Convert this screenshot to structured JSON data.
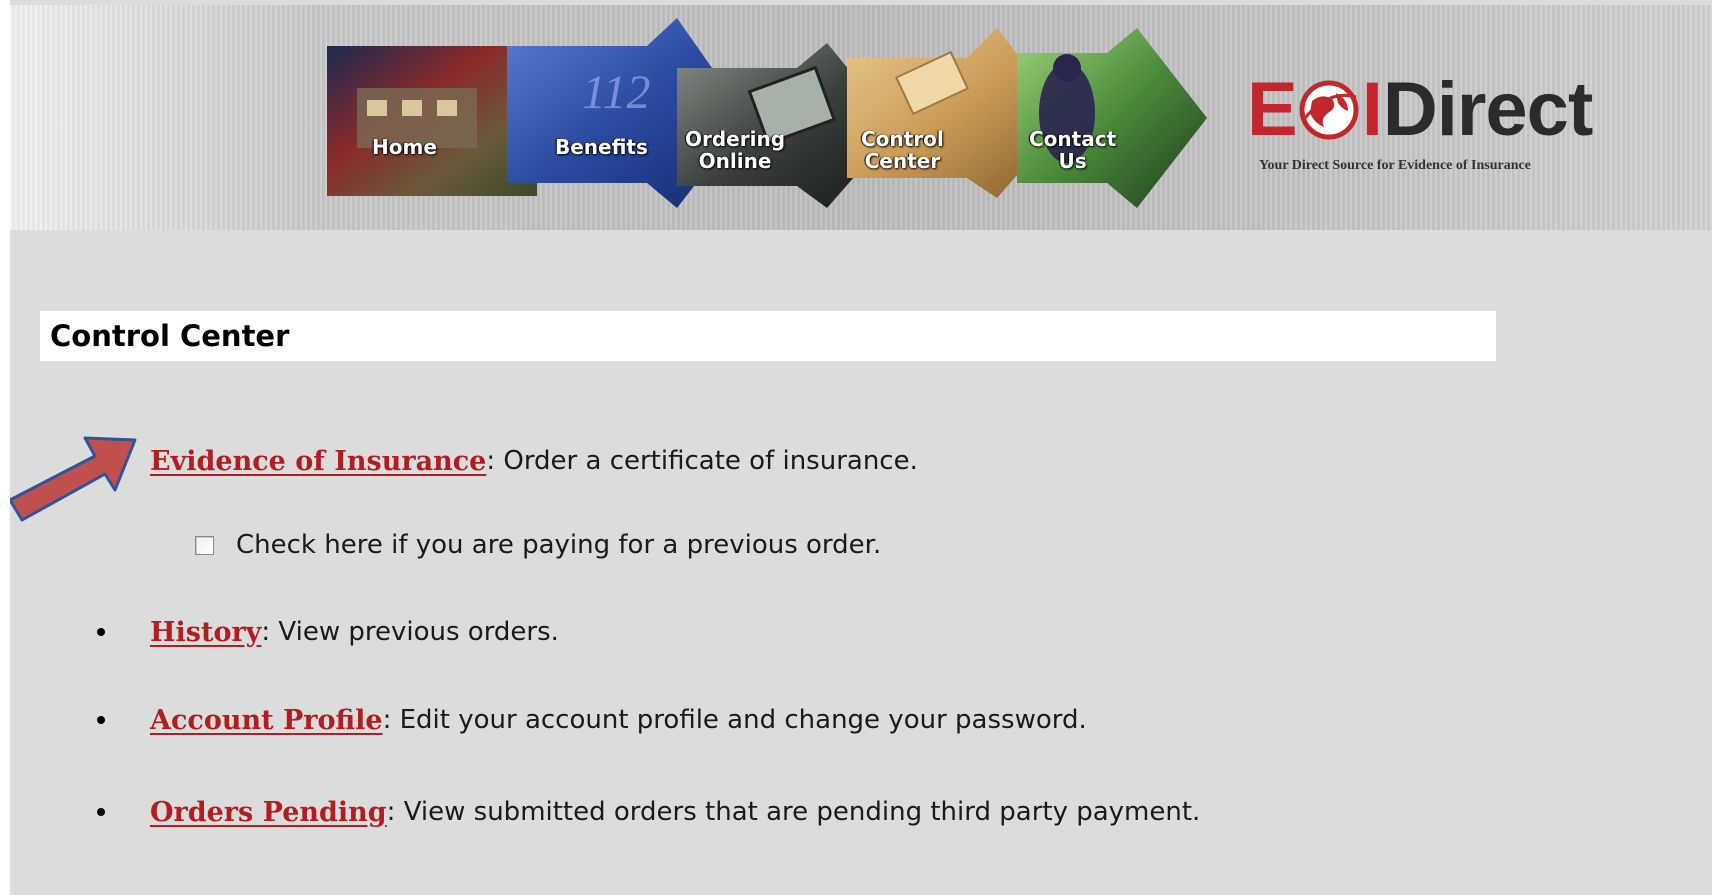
{
  "nav": {
    "items": [
      {
        "label": "Home"
      },
      {
        "label": "Benefits"
      },
      {
        "label": "Ordering\nOnline"
      },
      {
        "label": "Control\nCenter"
      },
      {
        "label": "Contact\nUs"
      }
    ]
  },
  "logo": {
    "e": "E",
    "i": "I",
    "direct": "Direct",
    "tagline": "Your Direct Source for Evidence of Insurance"
  },
  "page_title": "Control Center",
  "items": [
    {
      "link": "Evidence of Insurance",
      "desc": ": Order a certificate of insurance."
    },
    {
      "link": "History",
      "desc": ": View previous orders."
    },
    {
      "link": "Account Profile",
      "desc": ": Edit your account profile and change your password."
    },
    {
      "link": "Orders Pending",
      "desc": ": View submitted orders that are pending third party payment."
    }
  ],
  "previous_order_checkbox": {
    "label": "Check here if you are paying for a previous order.",
    "checked": false
  },
  "colors": {
    "link": "#b01e22",
    "logo_red": "#c1272d",
    "arrow_fill": "#c0504d",
    "arrow_stroke": "#2f5597"
  }
}
